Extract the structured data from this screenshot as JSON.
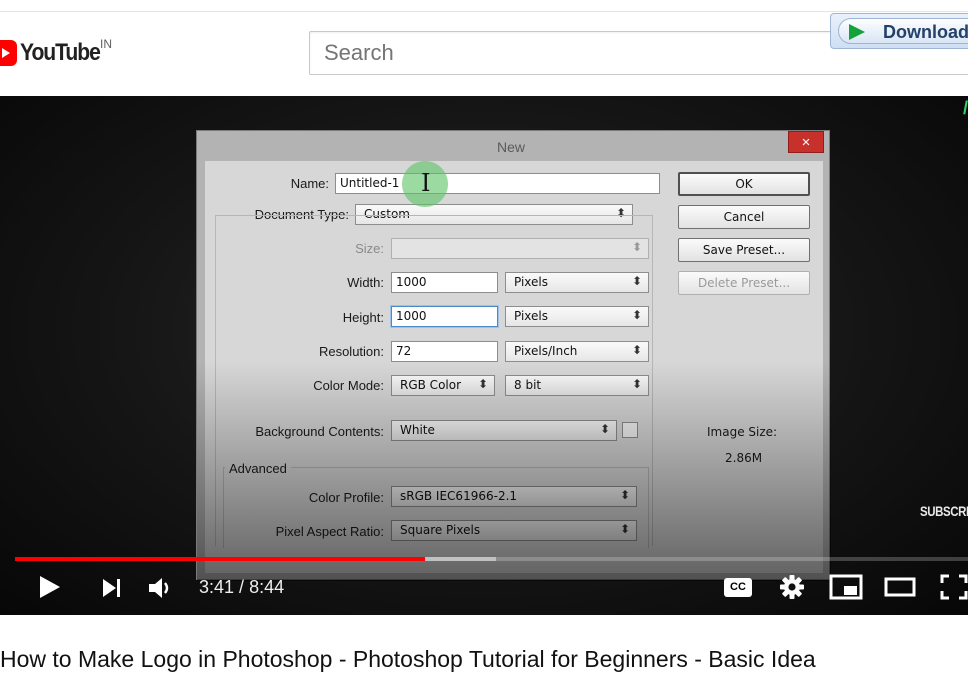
{
  "header": {
    "logo_text": "YouTube",
    "country_code": "IN",
    "search_placeholder": "Search",
    "download_button_label": "Download"
  },
  "player": {
    "corner_mark": "/",
    "subscribe_label": "SUBSCRI",
    "current_time": "3:41",
    "time_separator": " / ",
    "duration": "8:44",
    "played_fraction": 0.43,
    "buffered_fraction": 0.505,
    "icons": [
      "play-icon",
      "next-icon",
      "volume-icon",
      "captions-icon",
      "settings-icon",
      "miniplayer-icon",
      "theater-icon",
      "fullscreen-icon"
    ],
    "captions_label": "CC"
  },
  "dialog": {
    "title": "New",
    "close_glyph": "×",
    "name_label": "Name:",
    "name_value": "Untitled-1",
    "document_type_label": "Document Type:",
    "document_type_value": "Custom",
    "size_label": "Size:",
    "width_label": "Width:",
    "width_value": "1000",
    "width_unit": "Pixels",
    "height_label": "Height:",
    "height_value": "1000",
    "height_unit": "Pixels",
    "resolution_label": "Resolution:",
    "resolution_value": "72",
    "resolution_unit": "Pixels/Inch",
    "color_mode_label": "Color Mode:",
    "color_mode_value": "RGB Color",
    "bit_depth_value": "8 bit",
    "background_label": "Background Contents:",
    "background_value": "White",
    "advanced_label": "Advanced",
    "color_profile_label": "Color Profile:",
    "color_profile_value": "sRGB IEC61966-2.1",
    "pixel_aspect_label": "Pixel Aspect Ratio:",
    "pixel_aspect_value": "Square Pixels",
    "buttons": {
      "ok": "OK",
      "cancel": "Cancel",
      "save_preset": "Save Preset...",
      "delete_preset": "Delete Preset..."
    },
    "image_size_label": "Image Size:",
    "image_size_value": "2.86M",
    "cursor_glyph": "I"
  },
  "video_title": "How to Make Logo in Photoshop - Photoshop Tutorial for Beginners - Basic Idea",
  "colors": {
    "youtube_red": "#ff0000",
    "download_arrow": "#13a338",
    "cursor_highlight": "#5dc467"
  }
}
